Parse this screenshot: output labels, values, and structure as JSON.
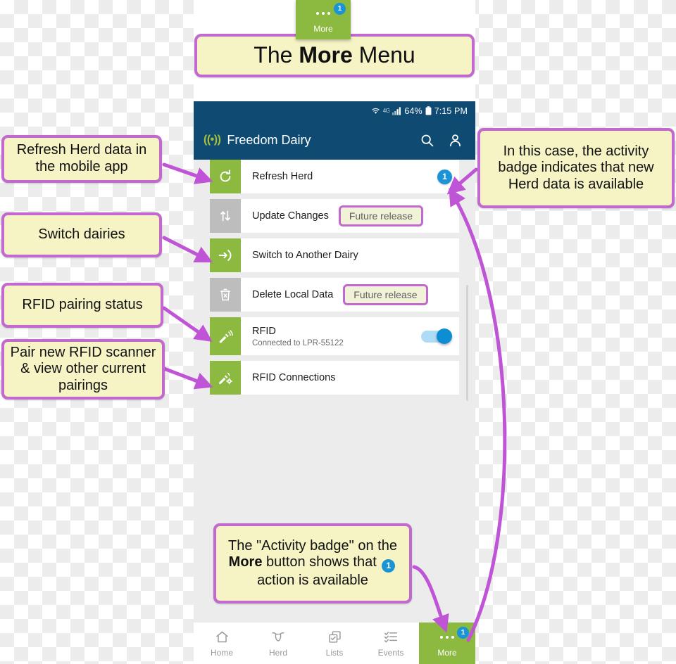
{
  "title_callout": {
    "pre": "The ",
    "strong": "More",
    "post": " Menu"
  },
  "more_chip": {
    "label": "More",
    "badge": "1",
    "icon": "ellipsis-icon"
  },
  "phone": {
    "status_bar": {
      "battery_percent": "64%",
      "time": "7:15 PM",
      "icons": [
        "wifi-icon",
        "network-4g-icon",
        "signal-bars-icon",
        "battery-icon"
      ]
    },
    "app_bar": {
      "logo_glyph": "((•))",
      "title": "Freedom Dairy",
      "actions": [
        {
          "name": "search-icon",
          "label": "Search"
        },
        {
          "name": "account-icon",
          "label": "Account"
        }
      ]
    },
    "menu_items": [
      {
        "icon": "refresh-icon",
        "tile": "green",
        "title": "Refresh Herd",
        "subtitle": "",
        "trailing": "activity-badge",
        "badge": "1"
      },
      {
        "icon": "sync-arrows-icon",
        "tile": "gray",
        "title": "Update Changes",
        "subtitle": "",
        "trailing": "future-release",
        "future_label": "Future release"
      },
      {
        "icon": "switch-dairy-icon",
        "tile": "green",
        "title": "Switch to Another Dairy",
        "subtitle": "",
        "trailing": "none"
      },
      {
        "icon": "delete-trash-icon",
        "tile": "gray",
        "title": "Delete Local Data",
        "subtitle": "",
        "trailing": "future-release",
        "future_label": "Future release"
      },
      {
        "icon": "rfid-scanner-icon",
        "tile": "green",
        "title": "RFID",
        "subtitle": "Connected to LPR-55122",
        "trailing": "toggle",
        "toggle_on": true
      },
      {
        "icon": "rfid-settings-icon",
        "tile": "green",
        "title": "RFID Connections",
        "subtitle": "",
        "trailing": "none"
      }
    ],
    "bottom_nav": [
      {
        "icon": "home-icon",
        "label": "Home",
        "active": false
      },
      {
        "icon": "cow-head-icon",
        "label": "Herd",
        "active": false
      },
      {
        "icon": "lists-icon",
        "label": "Lists",
        "active": false
      },
      {
        "icon": "events-icon",
        "label": "Events",
        "active": false
      },
      {
        "icon": "ellipsis-icon",
        "label": "More",
        "active": true,
        "badge": "1"
      }
    ]
  },
  "callouts": {
    "refresh": "Refresh Herd data in the mobile app",
    "switch": "Switch dairies",
    "rfid": "RFID pairing status",
    "pair": "Pair new RFID scanner & view other current pairings",
    "badge": "In this case, the activity badge indicates that new Herd data is available",
    "more_pre": "The \"Activity badge\" on the ",
    "more_strong": "More",
    "more_mid": " button shows that ",
    "more_badge": "1",
    "more_post": " action is available"
  },
  "colors": {
    "accent_green": "#8cb93f",
    "app_bar_blue": "#0e4a72",
    "badge_blue": "#1a94d4",
    "callout_border": "#c169cf",
    "callout_fill": "#f6f3c4",
    "toggle_on": "#0d8ed4",
    "disabled_gray": "#bdbdbd"
  }
}
